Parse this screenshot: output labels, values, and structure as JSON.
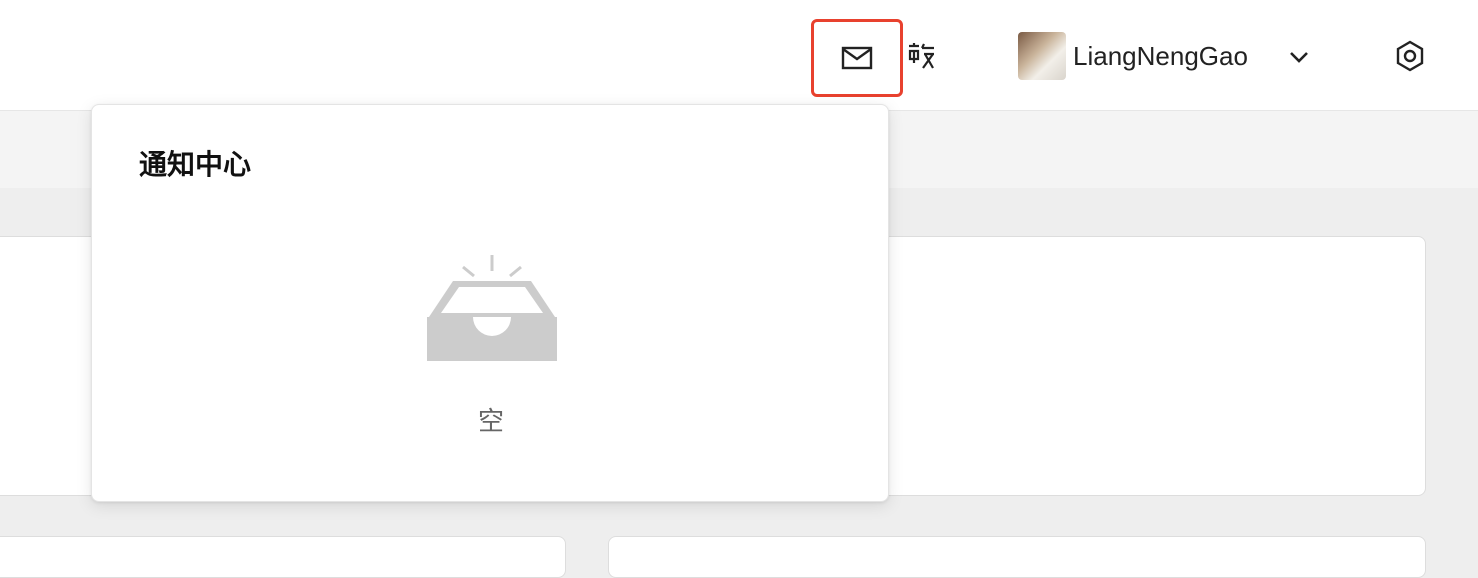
{
  "header": {
    "username": "LiangNengGao",
    "icons": {
      "mail": "mail-icon",
      "translate": "translate-icon",
      "chevron": "chevron-down-icon",
      "settings": "settings-icon"
    },
    "highlight_color": "#e8412e"
  },
  "notification_popover": {
    "title": "通知中心",
    "empty_text": "空"
  }
}
